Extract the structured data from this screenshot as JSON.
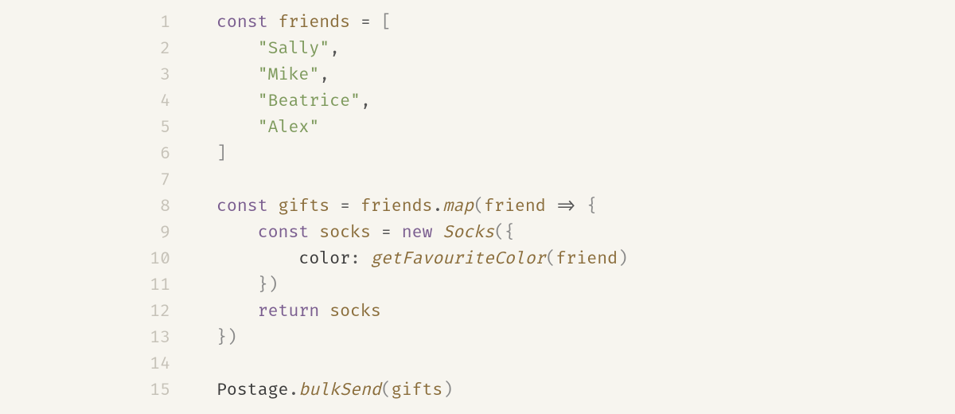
{
  "code": {
    "lines": [
      {
        "n": "1",
        "tokens": [
          [
            "kw",
            "const"
          ],
          [
            "",
            "",
            " "
          ],
          [
            "var",
            "friends"
          ],
          [
            "",
            "",
            " "
          ],
          [
            "op",
            "="
          ],
          [
            "",
            "",
            " "
          ],
          [
            "pun",
            "["
          ]
        ]
      },
      {
        "n": "2",
        "tokens": [
          [
            "",
            "",
            "    "
          ],
          [
            "str",
            "\"Sally\""
          ],
          [
            "op",
            ","
          ]
        ]
      },
      {
        "n": "3",
        "tokens": [
          [
            "",
            "",
            "    "
          ],
          [
            "str",
            "\"Mike\""
          ],
          [
            "op",
            ","
          ]
        ]
      },
      {
        "n": "4",
        "tokens": [
          [
            "",
            "",
            "    "
          ],
          [
            "str",
            "\"Beatrice\""
          ],
          [
            "op",
            ","
          ]
        ]
      },
      {
        "n": "5",
        "tokens": [
          [
            "",
            "",
            "    "
          ],
          [
            "str",
            "\"Alex\""
          ]
        ]
      },
      {
        "n": "6",
        "tokens": [
          [
            "pun",
            "]"
          ]
        ]
      },
      {
        "n": "7",
        "tokens": []
      },
      {
        "n": "8",
        "tokens": [
          [
            "kw",
            "const"
          ],
          [
            "",
            "",
            " "
          ],
          [
            "var",
            "gifts"
          ],
          [
            "",
            "",
            " "
          ],
          [
            "op",
            "="
          ],
          [
            "",
            "",
            " "
          ],
          [
            "var",
            "friends"
          ],
          [
            "op",
            "."
          ],
          [
            "fn",
            "map"
          ],
          [
            "pun",
            "("
          ],
          [
            "var",
            "friend"
          ],
          [
            "",
            "",
            " "
          ],
          [
            "op",
            "=>"
          ],
          [
            "",
            "",
            " "
          ],
          [
            "pun",
            "{"
          ]
        ]
      },
      {
        "n": "9",
        "tokens": [
          [
            "",
            "",
            "    "
          ],
          [
            "kw",
            "const"
          ],
          [
            "",
            "",
            " "
          ],
          [
            "var",
            "socks"
          ],
          [
            "",
            "",
            " "
          ],
          [
            "op",
            "="
          ],
          [
            "",
            "",
            " "
          ],
          [
            "kw",
            "new"
          ],
          [
            "",
            "",
            " "
          ],
          [
            "fn",
            "Socks"
          ],
          [
            "pun",
            "("
          ],
          [
            "pun",
            "{"
          ]
        ]
      },
      {
        "n": "10",
        "tokens": [
          [
            "",
            "",
            "        "
          ],
          [
            "prop",
            "color"
          ],
          [
            "op",
            ":"
          ],
          [
            "",
            "",
            " "
          ],
          [
            "fn",
            "getFavouriteColor"
          ],
          [
            "pun",
            "("
          ],
          [
            "var",
            "friend"
          ],
          [
            "pun",
            ")"
          ]
        ]
      },
      {
        "n": "11",
        "tokens": [
          [
            "",
            "",
            "    "
          ],
          [
            "pun",
            "}"
          ],
          [
            "pun",
            ")"
          ]
        ]
      },
      {
        "n": "12",
        "tokens": [
          [
            "",
            "",
            "    "
          ],
          [
            "kw",
            "return"
          ],
          [
            "",
            "",
            " "
          ],
          [
            "var",
            "socks"
          ]
        ]
      },
      {
        "n": "13",
        "tokens": [
          [
            "pun",
            "}"
          ],
          [
            "pun",
            ")"
          ]
        ]
      },
      {
        "n": "14",
        "tokens": []
      },
      {
        "n": "15",
        "tokens": [
          [
            "cls",
            "Postage"
          ],
          [
            "op",
            "."
          ],
          [
            "fn",
            "bulkSend"
          ],
          [
            "pun",
            "("
          ],
          [
            "var",
            "gifts"
          ],
          [
            "pun",
            ")"
          ]
        ]
      }
    ]
  }
}
